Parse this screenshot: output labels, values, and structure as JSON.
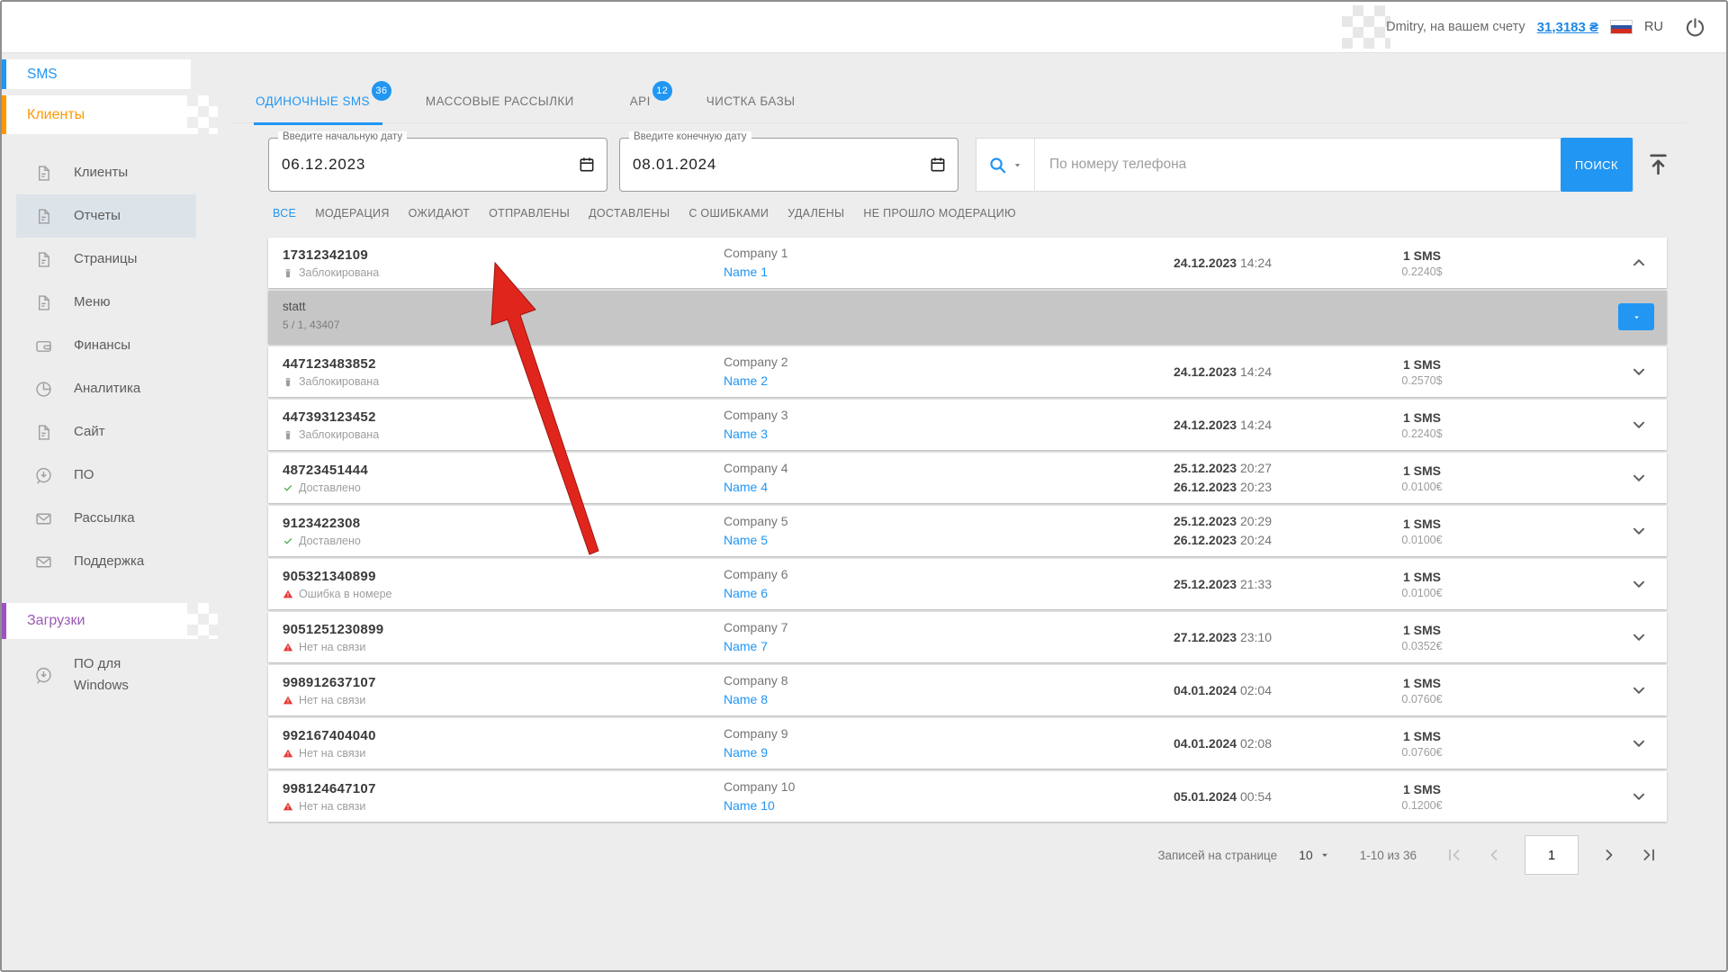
{
  "header": {
    "user_text": "Dmitry, на вашем счету",
    "balance": "31,3183 ₴",
    "language": "RU"
  },
  "sidebar": {
    "section_sms": "SMS",
    "section_clients": "Клиенты",
    "section_downloads": "Загрузки",
    "menu": [
      {
        "label": "Клиенты",
        "icon": "document",
        "active": false
      },
      {
        "label": "Отчеты",
        "icon": "document",
        "active": true
      },
      {
        "label": "Страницы",
        "icon": "document",
        "active": false
      },
      {
        "label": "Меню",
        "icon": "document",
        "active": false
      },
      {
        "label": "Финансы",
        "icon": "wallet",
        "active": false
      },
      {
        "label": "Аналитика",
        "icon": "pie",
        "active": false
      },
      {
        "label": "Сайт",
        "icon": "document",
        "active": false
      },
      {
        "label": "ПО",
        "icon": "download",
        "active": false
      },
      {
        "label": "Рассылка",
        "icon": "envelope",
        "active": false
      },
      {
        "label": "Поддержка",
        "icon": "envelope",
        "active": false
      }
    ],
    "downloads_menu": [
      {
        "label": "ПО для Windows",
        "icon": "download"
      }
    ]
  },
  "tabs": [
    {
      "label": "ОДИНОЧНЫЕ SMS",
      "badge": "36",
      "active": true
    },
    {
      "label": "МАССОВЫЕ РАССЫЛКИ",
      "badge": "",
      "active": false
    },
    {
      "label": "API",
      "badge": "12",
      "active": false
    },
    {
      "label": "ЧИСТКА БАЗЫ",
      "badge": "",
      "active": false
    }
  ],
  "search_panel": {
    "date_from_label": "Введите начальную дату",
    "date_from_value": "06.12.2023",
    "date_to_label": "Введите конечную дату",
    "date_to_value": "08.01.2024",
    "search_placeholder": "По номеру телефона",
    "search_button": "ПОИСК"
  },
  "status_filters": {
    "active": "ВСЕ",
    "items": [
      "ВСЕ",
      "МОДЕРАЦИЯ",
      "ОЖИДАЮТ",
      "ОТПРАВЛЕНЫ",
      "ДОСТАВЛЕНЫ",
      "С ОШИБКАМИ",
      "УДАЛЕНЫ",
      "НЕ ПРОШЛО МОДЕРАЦИЮ"
    ]
  },
  "table": {
    "expanded": {
      "title": "statt",
      "meta": "5 / 1, 43407"
    },
    "rows": [
      {
        "phone": "17312342109",
        "status": "Заблокирована",
        "status_type": "blocked",
        "company": "Company 1",
        "name": "Name 1",
        "dates": [
          {
            "d": "24.12.2023",
            "t": "14:24"
          }
        ],
        "sms": "1 SMS",
        "price": "0.2240$",
        "expanded": true
      },
      {
        "phone": "447123483852",
        "status": "Заблокирована",
        "status_type": "blocked",
        "company": "Company 2",
        "name": "Name 2",
        "dates": [
          {
            "d": "24.12.2023",
            "t": "14:24"
          }
        ],
        "sms": "1 SMS",
        "price": "0.2570$",
        "expanded": false
      },
      {
        "phone": "447393123452",
        "status": "Заблокирована",
        "status_type": "blocked",
        "company": "Company 3",
        "name": "Name 3",
        "dates": [
          {
            "d": "24.12.2023",
            "t": "14:24"
          }
        ],
        "sms": "1 SMS",
        "price": "0.2240$",
        "expanded": false
      },
      {
        "phone": "48723451444",
        "status": "Доставлено",
        "status_type": "delivered",
        "company": "Company 4",
        "name": "Name 4",
        "dates": [
          {
            "d": "25.12.2023",
            "t": "20:27"
          },
          {
            "d": "26.12.2023",
            "t": "20:23"
          }
        ],
        "sms": "1 SMS",
        "price": "0.0100€",
        "expanded": false
      },
      {
        "phone": "9123422308",
        "status": "Доставлено",
        "status_type": "delivered",
        "company": "Company 5",
        "name": "Name 5",
        "dates": [
          {
            "d": "25.12.2023",
            "t": "20:29"
          },
          {
            "d": "26.12.2023",
            "t": "20:24"
          }
        ],
        "sms": "1 SMS",
        "price": "0.0100€",
        "expanded": false
      },
      {
        "phone": "905321340899",
        "status": "Ошибка в номере",
        "status_type": "error",
        "company": "Company 6",
        "name": "Name 6",
        "dates": [
          {
            "d": "25.12.2023",
            "t": "21:33"
          }
        ],
        "sms": "1 SMS",
        "price": "0.0100€",
        "expanded": false
      },
      {
        "phone": "9051251230899",
        "status": "Нет на связи",
        "status_type": "error",
        "company": "Company 7",
        "name": "Name 7",
        "dates": [
          {
            "d": "27.12.2023",
            "t": "23:10"
          }
        ],
        "sms": "1 SMS",
        "price": "0.0352€",
        "expanded": false
      },
      {
        "phone": "998912637107",
        "status": "Нет на связи",
        "status_type": "error",
        "company": "Company 8",
        "name": "Name 8",
        "dates": [
          {
            "d": "04.01.2024",
            "t": "02:04"
          }
        ],
        "sms": "1 SMS",
        "price": "0.0760€",
        "expanded": false
      },
      {
        "phone": "992167404040",
        "status": "Нет на связи",
        "status_type": "error",
        "company": "Company 9",
        "name": "Name 9",
        "dates": [
          {
            "d": "04.01.2024",
            "t": "02:08"
          }
        ],
        "sms": "1 SMS",
        "price": "0.0760€",
        "expanded": false
      },
      {
        "phone": "998124647107",
        "status": "Нет на связи",
        "status_type": "error",
        "company": "Company 10",
        "name": "Name 10",
        "dates": [
          {
            "d": "05.01.2024",
            "t": "00:54"
          }
        ],
        "sms": "1 SMS",
        "price": "0.1200€",
        "expanded": false
      }
    ]
  },
  "pagination": {
    "label": "Записей на странице",
    "per_page": "10",
    "range": "1-10 из 36",
    "page": "1"
  },
  "colors": {
    "accent": "#2196f3",
    "clients": "#ff9800",
    "downloads": "#9b59b6",
    "success": "#4caf50",
    "error": "#e53935",
    "arrow_fill": "#e0261c",
    "arrow_stroke": "#9e1510"
  }
}
